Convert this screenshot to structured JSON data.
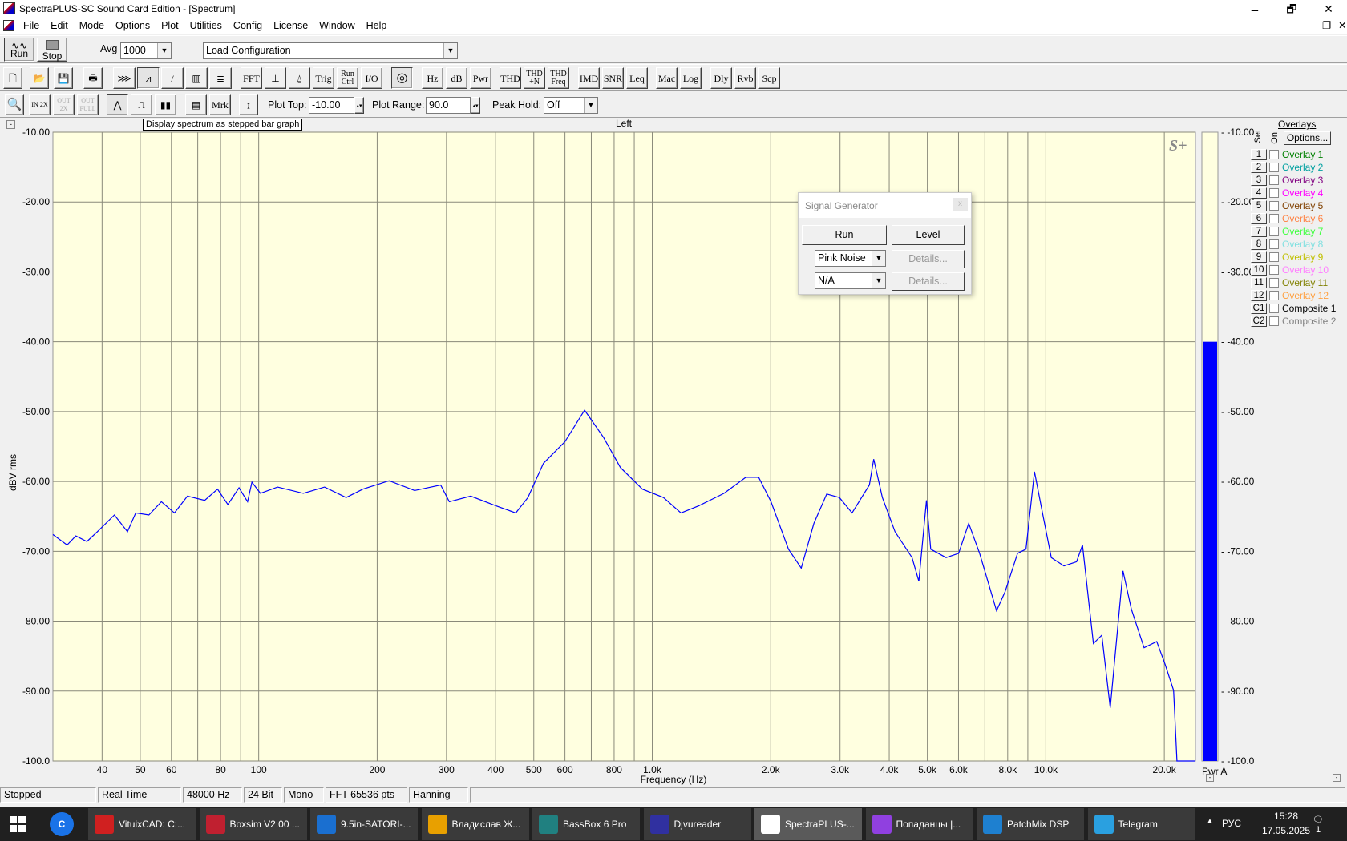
{
  "window": {
    "title": "SpectraPLUS-SC Sound Card Edition - [Spectrum]",
    "min": "🗕",
    "max": "🗗",
    "close": "✕",
    "mdi_min": "–",
    "mdi_restore": "❐",
    "mdi_close": "✕"
  },
  "menu": [
    "File",
    "Edit",
    "Mode",
    "Options",
    "Plot",
    "Utilities",
    "Config",
    "License",
    "Window",
    "Help"
  ],
  "toolbar1": {
    "run": "Run",
    "stop": "Stop",
    "avg_label": "Avg",
    "avg_value": "1000",
    "config": "Load Configuration"
  },
  "toolbar2": [
    "FFT",
    "Trig",
    "Run Ctrl",
    "I/O",
    "Hz",
    "dB",
    "Pwr",
    "THD",
    "THD +N",
    "THD Freq",
    "IMD",
    "SNR",
    "Leq",
    "Mac",
    "Log",
    "Dly",
    "Rvb",
    "Scp"
  ],
  "toolbar3": {
    "in2x": "IN 2X",
    "out2x": "OUT 2X",
    "outfull": "OUT FULL",
    "mrk": "Mrk",
    "plot_top_label": "Plot Top:",
    "plot_top": "-10.00",
    "plot_range_label": "Plot Range:",
    "plot_range": "90.0",
    "peak_hold_label": "Peak Hold:",
    "peak_hold": "Off"
  },
  "tooltip": "Display spectrum as stepped bar graph",
  "plot": {
    "channel": "Left",
    "logo": "S+",
    "meter_label": "Pwr A",
    "meter_value_db": -40,
    "collapse": "-"
  },
  "chart_data": {
    "type": "line",
    "title": "Left",
    "xlabel": "Frequency (Hz)",
    "ylabel": "dBV rms",
    "xscale": "log",
    "xlim": [
      30,
      24000
    ],
    "ylim": [
      -100,
      -10
    ],
    "grid": true,
    "yticks": [
      "-10.00",
      "-20.00",
      "-30.00",
      "-40.00",
      "-50.00",
      "-60.00",
      "-70.00",
      "-80.00",
      "-90.00",
      "-100.0"
    ],
    "xticks": [
      {
        "v": 40,
        "l": "40"
      },
      {
        "v": 50,
        "l": "50"
      },
      {
        "v": 60,
        "l": "60"
      },
      {
        "v": 80,
        "l": "80"
      },
      {
        "v": 100,
        "l": "100"
      },
      {
        "v": 200,
        "l": "200"
      },
      {
        "v": 300,
        "l": "300"
      },
      {
        "v": 400,
        "l": "400"
      },
      {
        "v": 500,
        "l": "500"
      },
      {
        "v": 600,
        "l": "600"
      },
      {
        "v": 800,
        "l": "800"
      },
      {
        "v": 1000,
        "l": "1.0k"
      },
      {
        "v": 2000,
        "l": "2.0k"
      },
      {
        "v": 3000,
        "l": "3.0k"
      },
      {
        "v": 4000,
        "l": "4.0k"
      },
      {
        "v": 5000,
        "l": "5.0k"
      },
      {
        "v": 6000,
        "l": "6.0k"
      },
      {
        "v": 8000,
        "l": "8.0k"
      },
      {
        "v": 10000,
        "l": "10.0k"
      },
      {
        "v": 20000,
        "l": "20.0k"
      }
    ],
    "meter_ticks": [
      "-10.00",
      "-20.00",
      "-30.00",
      "-40.00",
      "-50.00",
      "-60.00",
      "-70.00",
      "-80.00",
      "-90.00",
      "-100.0"
    ],
    "series": [
      {
        "name": "Left",
        "color": "#0000ff",
        "points": [
          [
            30,
            -67.6
          ],
          [
            32.6,
            -69.1
          ],
          [
            34.3,
            -67.8
          ],
          [
            36.6,
            -68.6
          ],
          [
            38.9,
            -67.2
          ],
          [
            43,
            -64.8
          ],
          [
            46.4,
            -67.2
          ],
          [
            48.7,
            -64.5
          ],
          [
            52.6,
            -64.8
          ],
          [
            56.6,
            -62.9
          ],
          [
            61.1,
            -64.5
          ],
          [
            65.9,
            -62.1
          ],
          [
            72.9,
            -62.7
          ],
          [
            78.6,
            -61.1
          ],
          [
            83.5,
            -63.3
          ],
          [
            89.1,
            -60.9
          ],
          [
            93.7,
            -62.9
          ],
          [
            96.1,
            -60.1
          ],
          [
            101,
            -61.7
          ],
          [
            111.7,
            -60.8
          ],
          [
            129.8,
            -61.7
          ],
          [
            147,
            -60.8
          ],
          [
            166.8,
            -62.3
          ],
          [
            184,
            -61.1
          ],
          [
            214.5,
            -59.9
          ],
          [
            249,
            -61.3
          ],
          [
            290,
            -60.5
          ],
          [
            305,
            -62.9
          ],
          [
            345.7,
            -62.1
          ],
          [
            401,
            -63.5
          ],
          [
            450,
            -64.5
          ],
          [
            483,
            -62.3
          ],
          [
            529,
            -57.4
          ],
          [
            600,
            -54.3
          ],
          [
            673,
            -49.8
          ],
          [
            752,
            -53.7
          ],
          [
            830,
            -58
          ],
          [
            944,
            -61.1
          ],
          [
            1068,
            -62.3
          ],
          [
            1183,
            -64.5
          ],
          [
            1312,
            -63.5
          ],
          [
            1522,
            -61.7
          ],
          [
            1729,
            -59.4
          ],
          [
            1863,
            -59.4
          ],
          [
            2003,
            -62.9
          ],
          [
            2219,
            -69.7
          ],
          [
            2390,
            -72.4
          ],
          [
            2574,
            -66
          ],
          [
            2775,
            -61.8
          ],
          [
            2988,
            -62.3
          ],
          [
            3219,
            -64.5
          ],
          [
            3562,
            -60.5
          ],
          [
            3653,
            -56.8
          ],
          [
            3843,
            -62.3
          ],
          [
            4138,
            -67.2
          ],
          [
            4571,
            -70.9
          ],
          [
            4758,
            -74.3
          ],
          [
            4975,
            -62.7
          ],
          [
            5100,
            -69.7
          ],
          [
            5576,
            -70.9
          ],
          [
            6003,
            -70.3
          ],
          [
            6370,
            -66
          ],
          [
            6790,
            -70.3
          ],
          [
            7496,
            -78.5
          ],
          [
            7876,
            -75.8
          ],
          [
            8475,
            -70.3
          ],
          [
            8905,
            -69.7
          ],
          [
            9356,
            -58.6
          ],
          [
            9829,
            -64.8
          ],
          [
            10327,
            -70.9
          ],
          [
            11118,
            -72.1
          ],
          [
            11968,
            -71.5
          ],
          [
            12390,
            -69.1
          ],
          [
            13207,
            -83.2
          ],
          [
            13875,
            -82
          ],
          [
            14578,
            -92.4
          ],
          [
            15702,
            -72.8
          ],
          [
            16500,
            -78.3
          ],
          [
            17770,
            -83.8
          ],
          [
            19130,
            -82.9
          ],
          [
            20100,
            -86.2
          ],
          [
            21120,
            -89.9
          ],
          [
            21540,
            -100
          ],
          [
            24000,
            -100
          ]
        ]
      }
    ]
  },
  "overlays": {
    "title": "Overlays",
    "set_label": "Set",
    "on_label": "On",
    "options": "Options...",
    "items": [
      {
        "set": "1",
        "name": "Overlay 1",
        "color": "#008000"
      },
      {
        "set": "2",
        "name": "Overlay 2",
        "color": "#00a0a0"
      },
      {
        "set": "3",
        "name": "Overlay 3",
        "color": "#800080"
      },
      {
        "set": "4",
        "name": "Overlay 4",
        "color": "#ff00ff"
      },
      {
        "set": "5",
        "name": "Overlay 5",
        "color": "#804000"
      },
      {
        "set": "6",
        "name": "Overlay 6",
        "color": "#ff8040"
      },
      {
        "set": "7",
        "name": "Overlay 7",
        "color": "#40ff40"
      },
      {
        "set": "8",
        "name": "Overlay 8",
        "color": "#80e0e0"
      },
      {
        "set": "9",
        "name": "Overlay 9",
        "color": "#c0c000"
      },
      {
        "set": "10",
        "name": "Overlay 10",
        "color": "#ff80ff"
      },
      {
        "set": "11",
        "name": "Overlay 11",
        "color": "#808000"
      },
      {
        "set": "12",
        "name": "Overlay 12",
        "color": "#ffa040"
      },
      {
        "set": "C1",
        "name": "Composite 1",
        "color": "#000000"
      },
      {
        "set": "C2",
        "name": "Composite 2",
        "color": "#808080"
      }
    ]
  },
  "signal_generator": {
    "title": "Signal Generator",
    "close": "x",
    "run": "Run",
    "level": "Level",
    "gen1": "Pink Noise",
    "gen2": "N/A",
    "details": "Details..."
  },
  "status": [
    "Stopped",
    "Real Time",
    "48000 Hz",
    "24 Bit",
    "Mono",
    "FFT 65536 pts",
    "Hanning"
  ],
  "taskbar": {
    "items": [
      {
        "label": "VituixCAD: C:...",
        "color": "#d02020"
      },
      {
        "label": "Boxsim V2.00 ...",
        "color": "#c02030"
      },
      {
        "label": "9.5in-SATORI-...",
        "color": "#1a6fd0"
      },
      {
        "label": "Владислав Ж...",
        "color": "#e8a000"
      },
      {
        "label": "BassBox 6 Pro",
        "color": "#208080"
      },
      {
        "label": "Djvureader",
        "color": "#3030a0"
      },
      {
        "label": "SpectraPLUS-...",
        "color": "#ffffff"
      },
      {
        "label": "Попаданцы |...",
        "color": "#9040e0"
      },
      {
        "label": "PatchMix DSP",
        "color": "#1e80d0"
      },
      {
        "label": "Telegram",
        "color": "#2aa0e0"
      }
    ],
    "lang": "РУС",
    "time": "15:28",
    "date": "17.05.2025",
    "notif": "1"
  }
}
